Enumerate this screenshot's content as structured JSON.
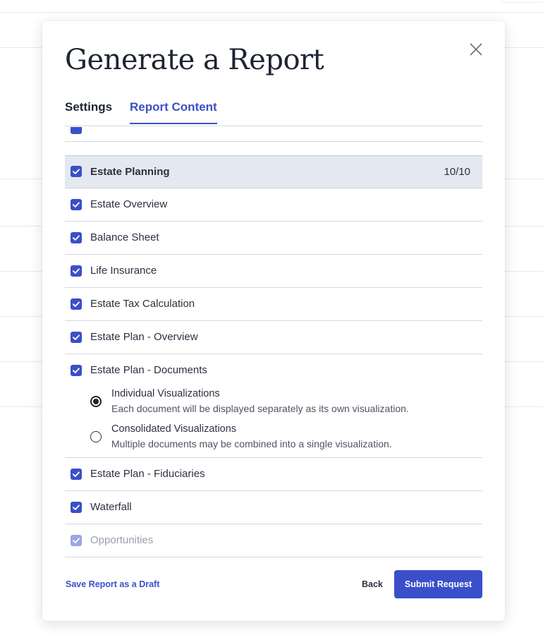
{
  "modal": {
    "title": "Generate a Report",
    "close_icon": "close-icon"
  },
  "tabs": [
    {
      "label": "Settings",
      "active": false
    },
    {
      "label": "Report Content",
      "active": true
    }
  ],
  "section": {
    "label": "Estate Planning",
    "count": "10/10",
    "checked": true
  },
  "items": [
    {
      "label": "Estate Overview",
      "checked": true
    },
    {
      "label": "Balance Sheet",
      "checked": true
    },
    {
      "label": "Life Insurance",
      "checked": true
    },
    {
      "label": "Estate Tax Calculation",
      "checked": true
    },
    {
      "label": "Estate Plan - Overview",
      "checked": true
    },
    {
      "label": "Estate Plan - Documents",
      "checked": true
    },
    {
      "label": "Estate Plan - Fiduciaries",
      "checked": true
    },
    {
      "label": "Waterfall",
      "checked": true
    },
    {
      "label": "Opportunities",
      "checked": true,
      "disabled": true
    }
  ],
  "documents_options": [
    {
      "title": "Individual Visualizations",
      "description": "Each document will be displayed separately as its own visualization.",
      "selected": true
    },
    {
      "title": "Consolidated Visualizations",
      "description": "Multiple documents may be combined into a single visualization.",
      "selected": false
    }
  ],
  "footer": {
    "save_draft": "Save Report as a Draft",
    "back": "Back",
    "submit": "Submit Request"
  },
  "colors": {
    "accent": "#3a4fc9",
    "header_row": "#e4e8f0"
  }
}
